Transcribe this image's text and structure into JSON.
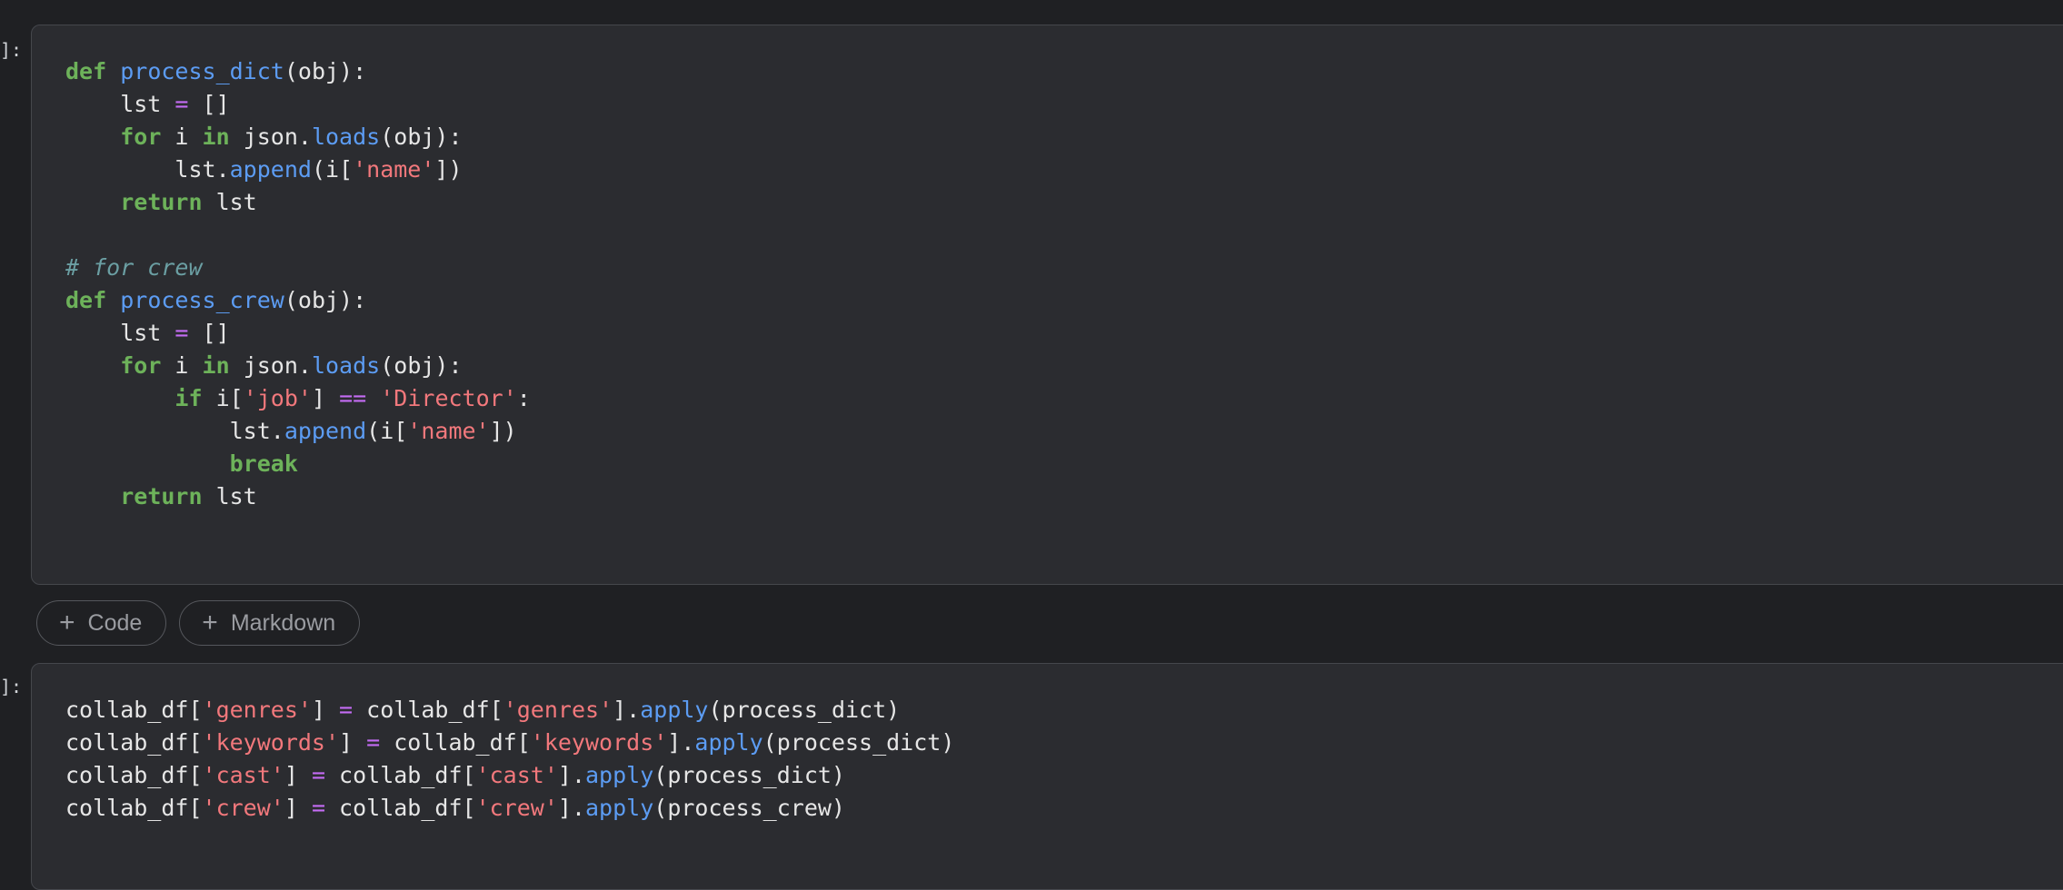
{
  "cells": [
    {
      "prompt": "]:",
      "lines": [
        [
          [
            "kw",
            "def"
          ],
          [
            "t",
            " "
          ],
          [
            "fn",
            "process_dict"
          ],
          [
            "t",
            "(obj):"
          ]
        ],
        [
          [
            "t",
            "    lst "
          ],
          [
            "op",
            "="
          ],
          [
            "t",
            " []"
          ]
        ],
        [
          [
            "t",
            "    "
          ],
          [
            "kw",
            "for"
          ],
          [
            "t",
            " i "
          ],
          [
            "kw",
            "in"
          ],
          [
            "t",
            " json."
          ],
          [
            "fn",
            "loads"
          ],
          [
            "t",
            "(obj):"
          ]
        ],
        [
          [
            "t",
            "        lst."
          ],
          [
            "fn",
            "append"
          ],
          [
            "t",
            "(i["
          ],
          [
            "str",
            "'name'"
          ],
          [
            "t",
            "])"
          ]
        ],
        [
          [
            "t",
            "    "
          ],
          [
            "kw",
            "return"
          ],
          [
            "t",
            " lst"
          ]
        ],
        [
          [
            "t",
            ""
          ]
        ],
        [
          [
            "cm",
            "# for crew"
          ]
        ],
        [
          [
            "kw",
            "def"
          ],
          [
            "t",
            " "
          ],
          [
            "fn",
            "process_crew"
          ],
          [
            "t",
            "(obj):"
          ]
        ],
        [
          [
            "t",
            "    lst "
          ],
          [
            "op",
            "="
          ],
          [
            "t",
            " []"
          ]
        ],
        [
          [
            "t",
            "    "
          ],
          [
            "kw",
            "for"
          ],
          [
            "t",
            " i "
          ],
          [
            "kw",
            "in"
          ],
          [
            "t",
            " json."
          ],
          [
            "fn",
            "loads"
          ],
          [
            "t",
            "(obj):"
          ]
        ],
        [
          [
            "t",
            "        "
          ],
          [
            "kw",
            "if"
          ],
          [
            "t",
            " i["
          ],
          [
            "str",
            "'job'"
          ],
          [
            "t",
            "] "
          ],
          [
            "op",
            "=="
          ],
          [
            "t",
            " "
          ],
          [
            "str",
            "'Director'"
          ],
          [
            "t",
            ":"
          ]
        ],
        [
          [
            "t",
            "            lst."
          ],
          [
            "fn",
            "append"
          ],
          [
            "t",
            "(i["
          ],
          [
            "str",
            "'name'"
          ],
          [
            "t",
            "])"
          ]
        ],
        [
          [
            "t",
            "            "
          ],
          [
            "kw",
            "break"
          ]
        ],
        [
          [
            "t",
            "    "
          ],
          [
            "kw",
            "return"
          ],
          [
            "t",
            " lst"
          ]
        ]
      ]
    },
    {
      "prompt": "]:",
      "lines": [
        [
          [
            "t",
            "collab_df["
          ],
          [
            "str",
            "'genres'"
          ],
          [
            "t",
            "] "
          ],
          [
            "op",
            "="
          ],
          [
            "t",
            " collab_df["
          ],
          [
            "str",
            "'genres'"
          ],
          [
            "t",
            "]."
          ],
          [
            "fn",
            "apply"
          ],
          [
            "t",
            "(process_dict)"
          ]
        ],
        [
          [
            "t",
            "collab_df["
          ],
          [
            "str",
            "'keywords'"
          ],
          [
            "t",
            "] "
          ],
          [
            "op",
            "="
          ],
          [
            "t",
            " collab_df["
          ],
          [
            "str",
            "'keywords'"
          ],
          [
            "t",
            "]."
          ],
          [
            "fn",
            "apply"
          ],
          [
            "t",
            "(process_dict)"
          ]
        ],
        [
          [
            "t",
            "collab_df["
          ],
          [
            "str",
            "'cast'"
          ],
          [
            "t",
            "] "
          ],
          [
            "op",
            "="
          ],
          [
            "t",
            " collab_df["
          ],
          [
            "str",
            "'cast'"
          ],
          [
            "t",
            "]."
          ],
          [
            "fn",
            "apply"
          ],
          [
            "t",
            "(process_dict)"
          ]
        ],
        [
          [
            "t",
            "collab_df["
          ],
          [
            "str",
            "'crew'"
          ],
          [
            "t",
            "] "
          ],
          [
            "op",
            "="
          ],
          [
            "t",
            " collab_df["
          ],
          [
            "str",
            "'crew'"
          ],
          [
            "t",
            "]."
          ],
          [
            "fn",
            "apply"
          ],
          [
            "t",
            "(process_crew)"
          ]
        ]
      ]
    }
  ],
  "toolbar": {
    "code_label": "Code",
    "markdown_label": "Markdown",
    "plus_glyph": "+"
  },
  "colors": {
    "keyword": "#6db25a",
    "function": "#5c9cf3",
    "string": "#f2787c",
    "operator": "#c46cf4",
    "comment": "#6b9fa3"
  }
}
